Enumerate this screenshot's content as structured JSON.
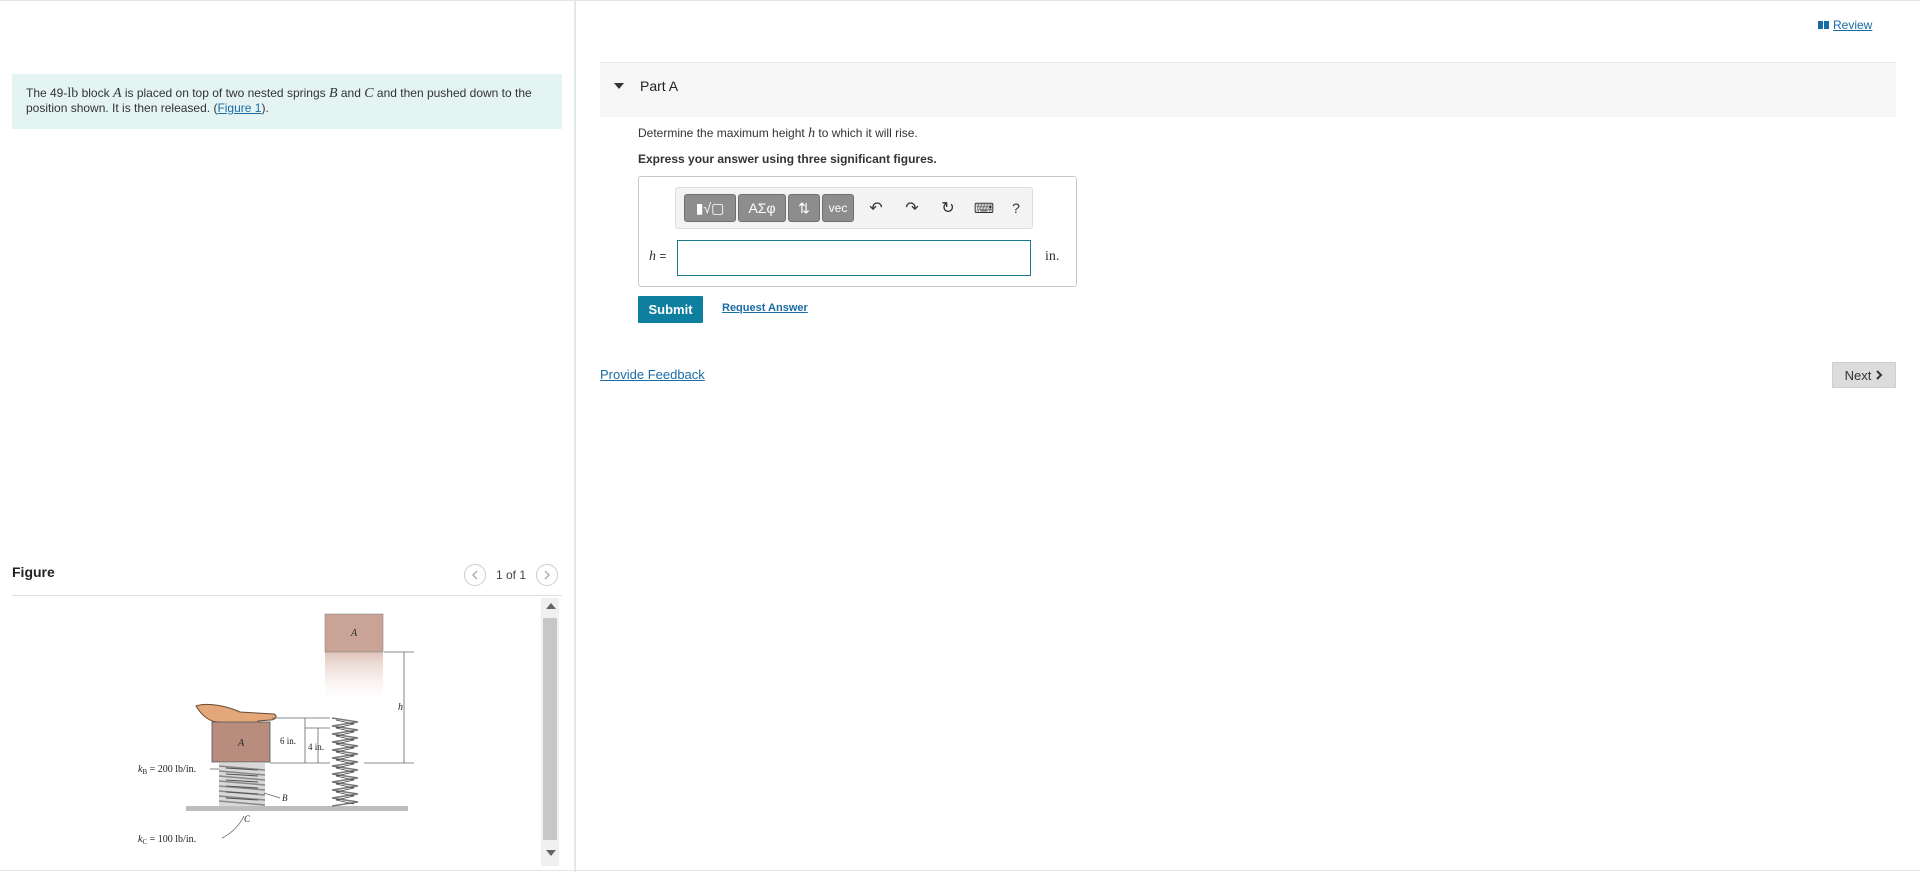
{
  "header": {
    "review_label": "Review"
  },
  "problem": {
    "text_1": "The 49-",
    "unit_lb": "lb",
    "text_2": " block ",
    "var_a": "A",
    "text_3": " is placed on top of two nested springs ",
    "var_b": "B",
    "text_4": " and ",
    "var_c": "C",
    "text_5": " and then pushed down to the position shown. It is then released. (",
    "figure_link": "Figure 1",
    "text_6": ")."
  },
  "figure": {
    "title": "Figure",
    "counter": "1 of 1",
    "labels": {
      "block_top": "A",
      "block_bottom": "A",
      "h": "h",
      "six_in": "6 in.",
      "four_in": "4 in.",
      "kb": "k",
      "kb_sub": "B",
      "kb_val": " = 200 lb/in.",
      "kc": "k",
      "kc_sub": "C",
      "kc_val": " = 100 lb/in.",
      "spring_b": "B",
      "spring_c": "C"
    }
  },
  "part": {
    "title": "Part A",
    "question_1": "Determine the maximum height ",
    "question_var": "h",
    "question_2": " to which it will rise.",
    "instruction": "Express your answer using three significant figures.",
    "toolbar": {
      "templates": "▮√▢",
      "greek": "ΑΣφ",
      "arrows": "⇅",
      "vec": "vec",
      "undo": "↶",
      "redo": "↷",
      "reset": "↻",
      "keyboard": "⌨",
      "help": "?"
    },
    "answer_var": "h",
    "answer_eq": " =",
    "answer_value": "",
    "answer_unit": "in.",
    "submit_label": "Submit",
    "request_label": "Request Answer"
  },
  "footer": {
    "feedback_label": "Provide Feedback",
    "next_label": "Next"
  }
}
